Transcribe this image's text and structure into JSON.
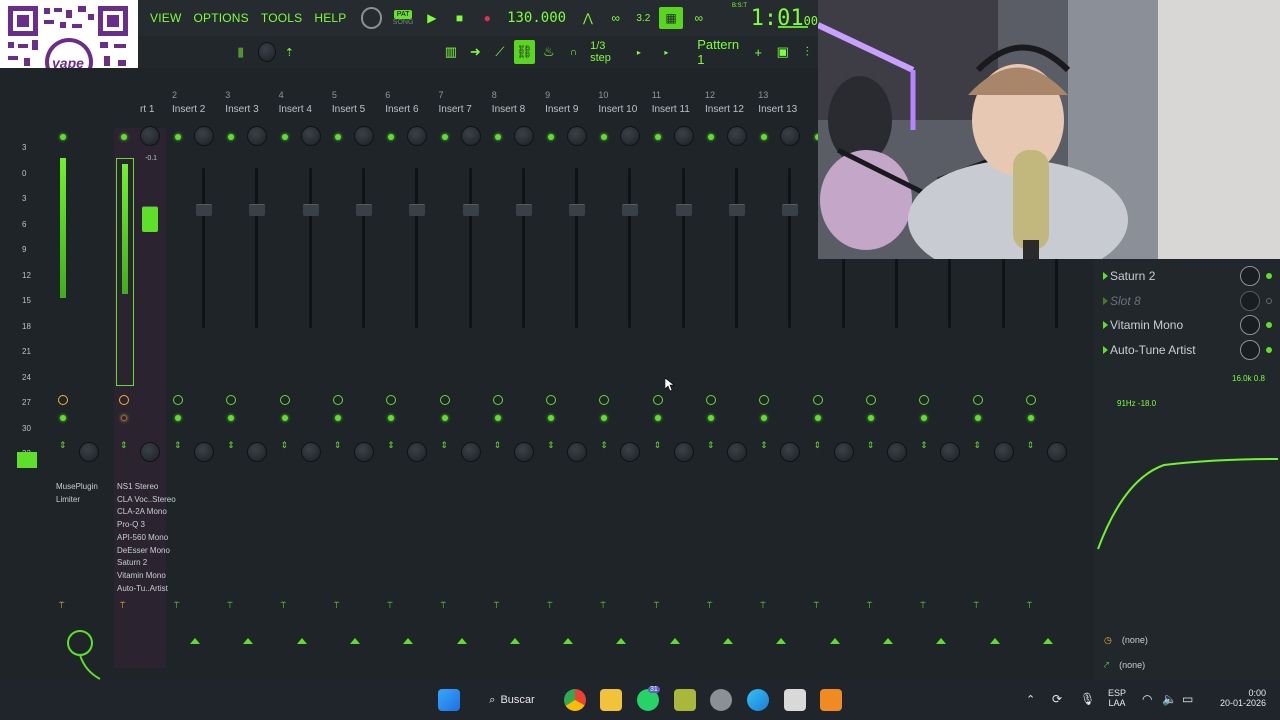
{
  "menu": {
    "items": [
      "VIEW",
      "OPTIONS",
      "TOOLS",
      "HELP"
    ],
    "pat_label": "PAT",
    "song_label": "SONG",
    "tempo": "130.000",
    "time_main": "1:01",
    "time_sub": "00",
    "time_unit": "B:S:T"
  },
  "toolbar": {
    "step": "1/3 step",
    "pattern": "Pattern 1",
    "plus": "+"
  },
  "mixer": {
    "strip_numbers": [
      "2",
      "3",
      "4",
      "5",
      "6",
      "7",
      "8",
      "9",
      "10",
      "11",
      "12",
      "13"
    ],
    "strip_labels": [
      "rt 1",
      "Insert 2",
      "Insert 3",
      "Insert 4",
      "Insert 5",
      "Insert 6",
      "Insert 7",
      "Insert 8",
      "Insert 9",
      "Insert 10",
      "Insert 11",
      "Insert 12",
      "Insert 13"
    ],
    "selected_peak": "-0.1",
    "scale": [
      "3",
      "0",
      "3",
      "6",
      "9",
      "12",
      "15",
      "18",
      "21",
      "24",
      "27",
      "30",
      "33"
    ],
    "master_plugins": [
      "MusePlugin",
      "Limiter"
    ],
    "insert1_plugins": [
      "NS1 Stereo",
      "CLA Voc..Stereo",
      "CLA-2A Mono",
      "Pro-Q 3",
      "API-560 Mono",
      "DeEsser Mono",
      "Saturn 2",
      "Vitamin Mono",
      "Auto-Tu..Artist"
    ]
  },
  "right_panel": {
    "slots": [
      {
        "label": "Saturn 2",
        "active": true
      },
      {
        "label": "Slot 8",
        "active": false
      },
      {
        "label": "Vitamin Mono",
        "active": true
      },
      {
        "label": "Auto-Tune Artist",
        "active": true
      }
    ],
    "eq_hi": "16.0k 0.8",
    "eq_lo": "91Hz -18.0",
    "route_in": "(none)",
    "route_out": "(none)"
  },
  "qr": {
    "logo_text": "yape"
  },
  "taskbar": {
    "search_label": "Buscar",
    "whatsapp_badge": "31",
    "lang": "ESP",
    "lang_sub": "LAA",
    "clock_time": "0:00",
    "clock_date": "20-01-2026"
  },
  "colors": {
    "accent": "#5ee02a",
    "background": "#1f2428",
    "selected_strip": "#2b2430"
  }
}
